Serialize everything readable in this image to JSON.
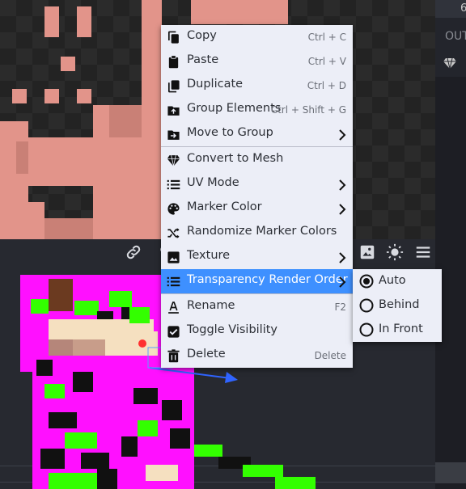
{
  "context_menu": {
    "items": [
      {
        "label": "Copy",
        "shortcut": "Ctrl + C",
        "icon": "copy-icon"
      },
      {
        "label": "Paste",
        "shortcut": "Ctrl + V",
        "icon": "paste-icon"
      },
      {
        "label": "Duplicate",
        "shortcut": "Ctrl + D",
        "icon": "duplicate-icon"
      },
      {
        "label": "Group Elements",
        "shortcut": "Ctrl + Shift + G",
        "icon": "group-icon"
      },
      {
        "label": "Move to Group",
        "icon": "move-to-group-icon",
        "submenu": true
      },
      {
        "label": "Convert to Mesh",
        "icon": "gem-icon"
      },
      {
        "label": "UV Mode",
        "icon": "list-icon",
        "submenu": true
      },
      {
        "label": "Marker Color",
        "icon": "palette-icon",
        "submenu": true
      },
      {
        "label": "Randomize Marker Colors",
        "icon": "shuffle-icon"
      },
      {
        "label": "Texture",
        "icon": "image-icon",
        "submenu": true
      },
      {
        "label": "Transparency Render Order",
        "icon": "list-icon",
        "submenu": true,
        "highlighted": true
      },
      {
        "label": "Rename",
        "shortcut": "F2",
        "icon": "rename-icon"
      },
      {
        "label": "Toggle Visibility",
        "icon": "checkbox-icon"
      },
      {
        "label": "Delete",
        "shortcut": "Delete",
        "icon": "trash-icon"
      }
    ]
  },
  "submenu": {
    "options": [
      {
        "label": "Auto",
        "selected": true
      },
      {
        "label": "Behind",
        "selected": false
      },
      {
        "label": "In Front",
        "selected": false
      }
    ]
  },
  "right_panel": {
    "number": "6",
    "output_label": "OUT"
  },
  "colors": {
    "highlight": "#3e90ff",
    "menu_bg": "#eceef7",
    "skin_pink": "#e2948a",
    "model_magenta": "#ff10ff",
    "model_green": "#33ff00"
  }
}
